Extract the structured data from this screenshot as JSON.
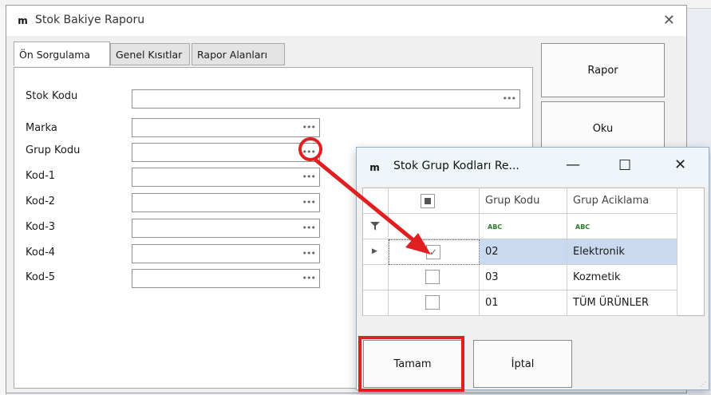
{
  "main_window": {
    "title": "Stok Bakiye Raporu",
    "app_icon": "m-logo-icon",
    "close_glyph": "✕",
    "tabs": [
      "Ön Sorgulama",
      "Genel Kısıtlar",
      "Rapor Alanları"
    ],
    "active_tab": 0,
    "fields": [
      {
        "label": "Stok Kodu",
        "value": ""
      },
      {
        "label": "Marka",
        "value": ""
      },
      {
        "label": "Grup Kodu",
        "value": ""
      },
      {
        "label": "Kod-1",
        "value": ""
      },
      {
        "label": "Kod-2",
        "value": ""
      },
      {
        "label": "Kod-3",
        "value": ""
      },
      {
        "label": "Kod-4",
        "value": ""
      },
      {
        "label": "Kod-5",
        "value": ""
      }
    ],
    "ellipsis_label": "•••",
    "buttons": {
      "rapor": "Rapor",
      "oku": "Oku"
    }
  },
  "popup": {
    "title": "Stok Grup Kodları Re...",
    "minimize_glyph": "—",
    "maximize_glyph": "☐",
    "close_glyph": "✕",
    "columns": [
      "Grup Kodu",
      "Grup Aciklama"
    ],
    "filter_placeholder": "ABC",
    "rows": [
      {
        "code": "02",
        "desc": "Elektronik",
        "checked": true,
        "selected": true
      },
      {
        "code": "03",
        "desc": "Kozmetik",
        "checked": false,
        "selected": false
      },
      {
        "code": "01",
        "desc": "TÜM ÜRÜNLER",
        "checked": false,
        "selected": false
      }
    ],
    "buttons": {
      "ok": "Tamam",
      "cancel": "İptal"
    }
  },
  "annotations": {
    "color": "#e02020"
  }
}
